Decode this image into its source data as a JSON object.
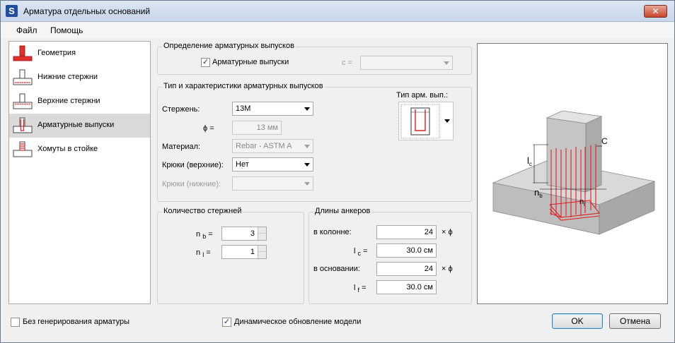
{
  "window": {
    "title": "Арматура отдельных оснований",
    "app_icon": "S",
    "close_label": "✕"
  },
  "menu": {
    "file": "Файл",
    "help": "Помощь"
  },
  "nav": {
    "items": [
      {
        "label": "Геометрия",
        "icon": "geometry-icon"
      },
      {
        "label": "Нижние стержни",
        "icon": "bottom-bars-icon"
      },
      {
        "label": "Верхние стержни",
        "icon": "top-bars-icon"
      },
      {
        "label": "Арматурные выпуски",
        "icon": "dowels-icon",
        "selected": true
      },
      {
        "label": "Хомуты в стойке",
        "icon": "stirrups-icon"
      }
    ]
  },
  "dowel_definition": {
    "title": "Определение арматурных выпусков",
    "checkbox_label": "Арматурные выпуски",
    "checked": true,
    "c_label": "c ="
  },
  "dowel_type": {
    "title": "Тип и характеристики арматурных выпусков",
    "bar_label": "Стержень:",
    "bar_value": "13M",
    "phi_label": "ϕ =",
    "phi_value": "13 мм",
    "material_label": "Материал:",
    "material_value": "Rebar - ASTM A",
    "hooks_top_label": "Крюки (верхние):",
    "hooks_top_value": "Нет",
    "hooks_bottom_label": "Крюки (нижние):",
    "type_label": "Тип арм. вып.:"
  },
  "count": {
    "title": "Количество стержней",
    "nb_label": "n",
    "nb_sub": "b",
    "nb_value": "3",
    "nl_label": "n",
    "nl_sub": "l",
    "nl_value": "1",
    "eq": "="
  },
  "anchor": {
    "title": "Длины анкеров",
    "in_column_label": "в колонне:",
    "in_column_value": "24",
    "times_phi": "× ϕ",
    "lc_label": "l",
    "lc_sub": "c",
    "lc_value": "30.0 см",
    "in_base_label": "в основании:",
    "in_base_value": "24",
    "lf_label": "l",
    "lf_sub": "f",
    "lf_value": "30.0 см"
  },
  "preview": {
    "label_lc": "l",
    "label_lc_sub": "c",
    "label_c": "C",
    "label_nb": "n",
    "label_nb_sub": "b",
    "label_nl": "n",
    "label_nl_sub": "l"
  },
  "footer": {
    "no_generation_label": "Без генерирования арматуры",
    "no_generation_checked": false,
    "dynamic_update_label": "Динамическое обновление модели",
    "dynamic_update_checked": true,
    "ok_label": "OK",
    "cancel_label": "Отмена"
  },
  "colors": {
    "rebar": "#e02020",
    "concrete": "#c8c8c8"
  }
}
